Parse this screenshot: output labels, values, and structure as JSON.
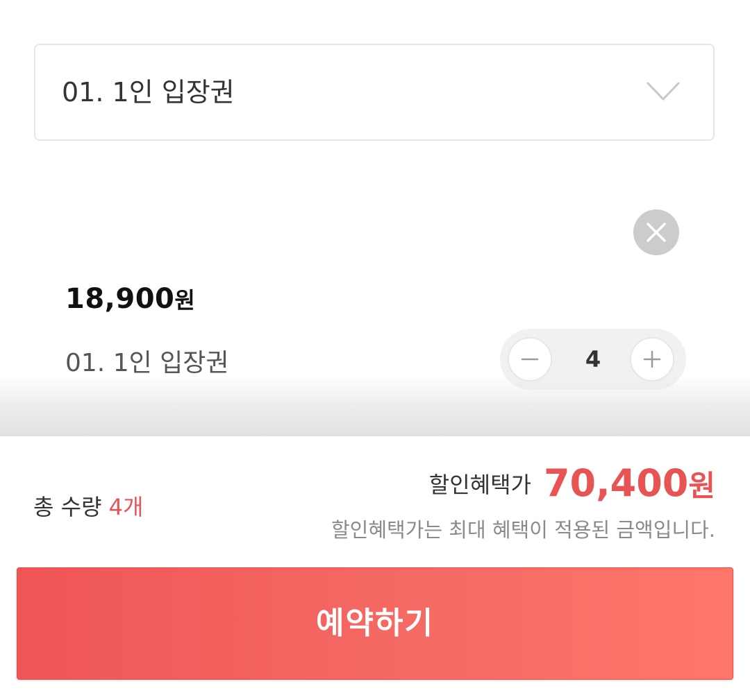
{
  "option_select": {
    "selected_label": "01. 1인 입장권",
    "icon": "chevron-down-icon"
  },
  "selected_item": {
    "price_number": "18,900",
    "price_unit": "원",
    "name": "01. 1인 입장권",
    "quantity": "4",
    "remove_icon": "close-icon",
    "minus_icon": "minus-icon",
    "plus_icon": "plus-icon"
  },
  "summary": {
    "total_qty_label": "총 수량",
    "total_qty_value": "4개",
    "discount_label": "할인혜택가",
    "discount_price_number": "70,400",
    "discount_price_unit": "원",
    "discount_note": "할인혜택가는 최대 혜택이 적용된 금액입니다."
  },
  "reserve_button": {
    "label": "예약하기"
  },
  "colors": {
    "accent": "#e85454",
    "button_gradient_start": "#ef5557",
    "button_gradient_end": "#fe7769",
    "border": "#e6e6e6"
  }
}
